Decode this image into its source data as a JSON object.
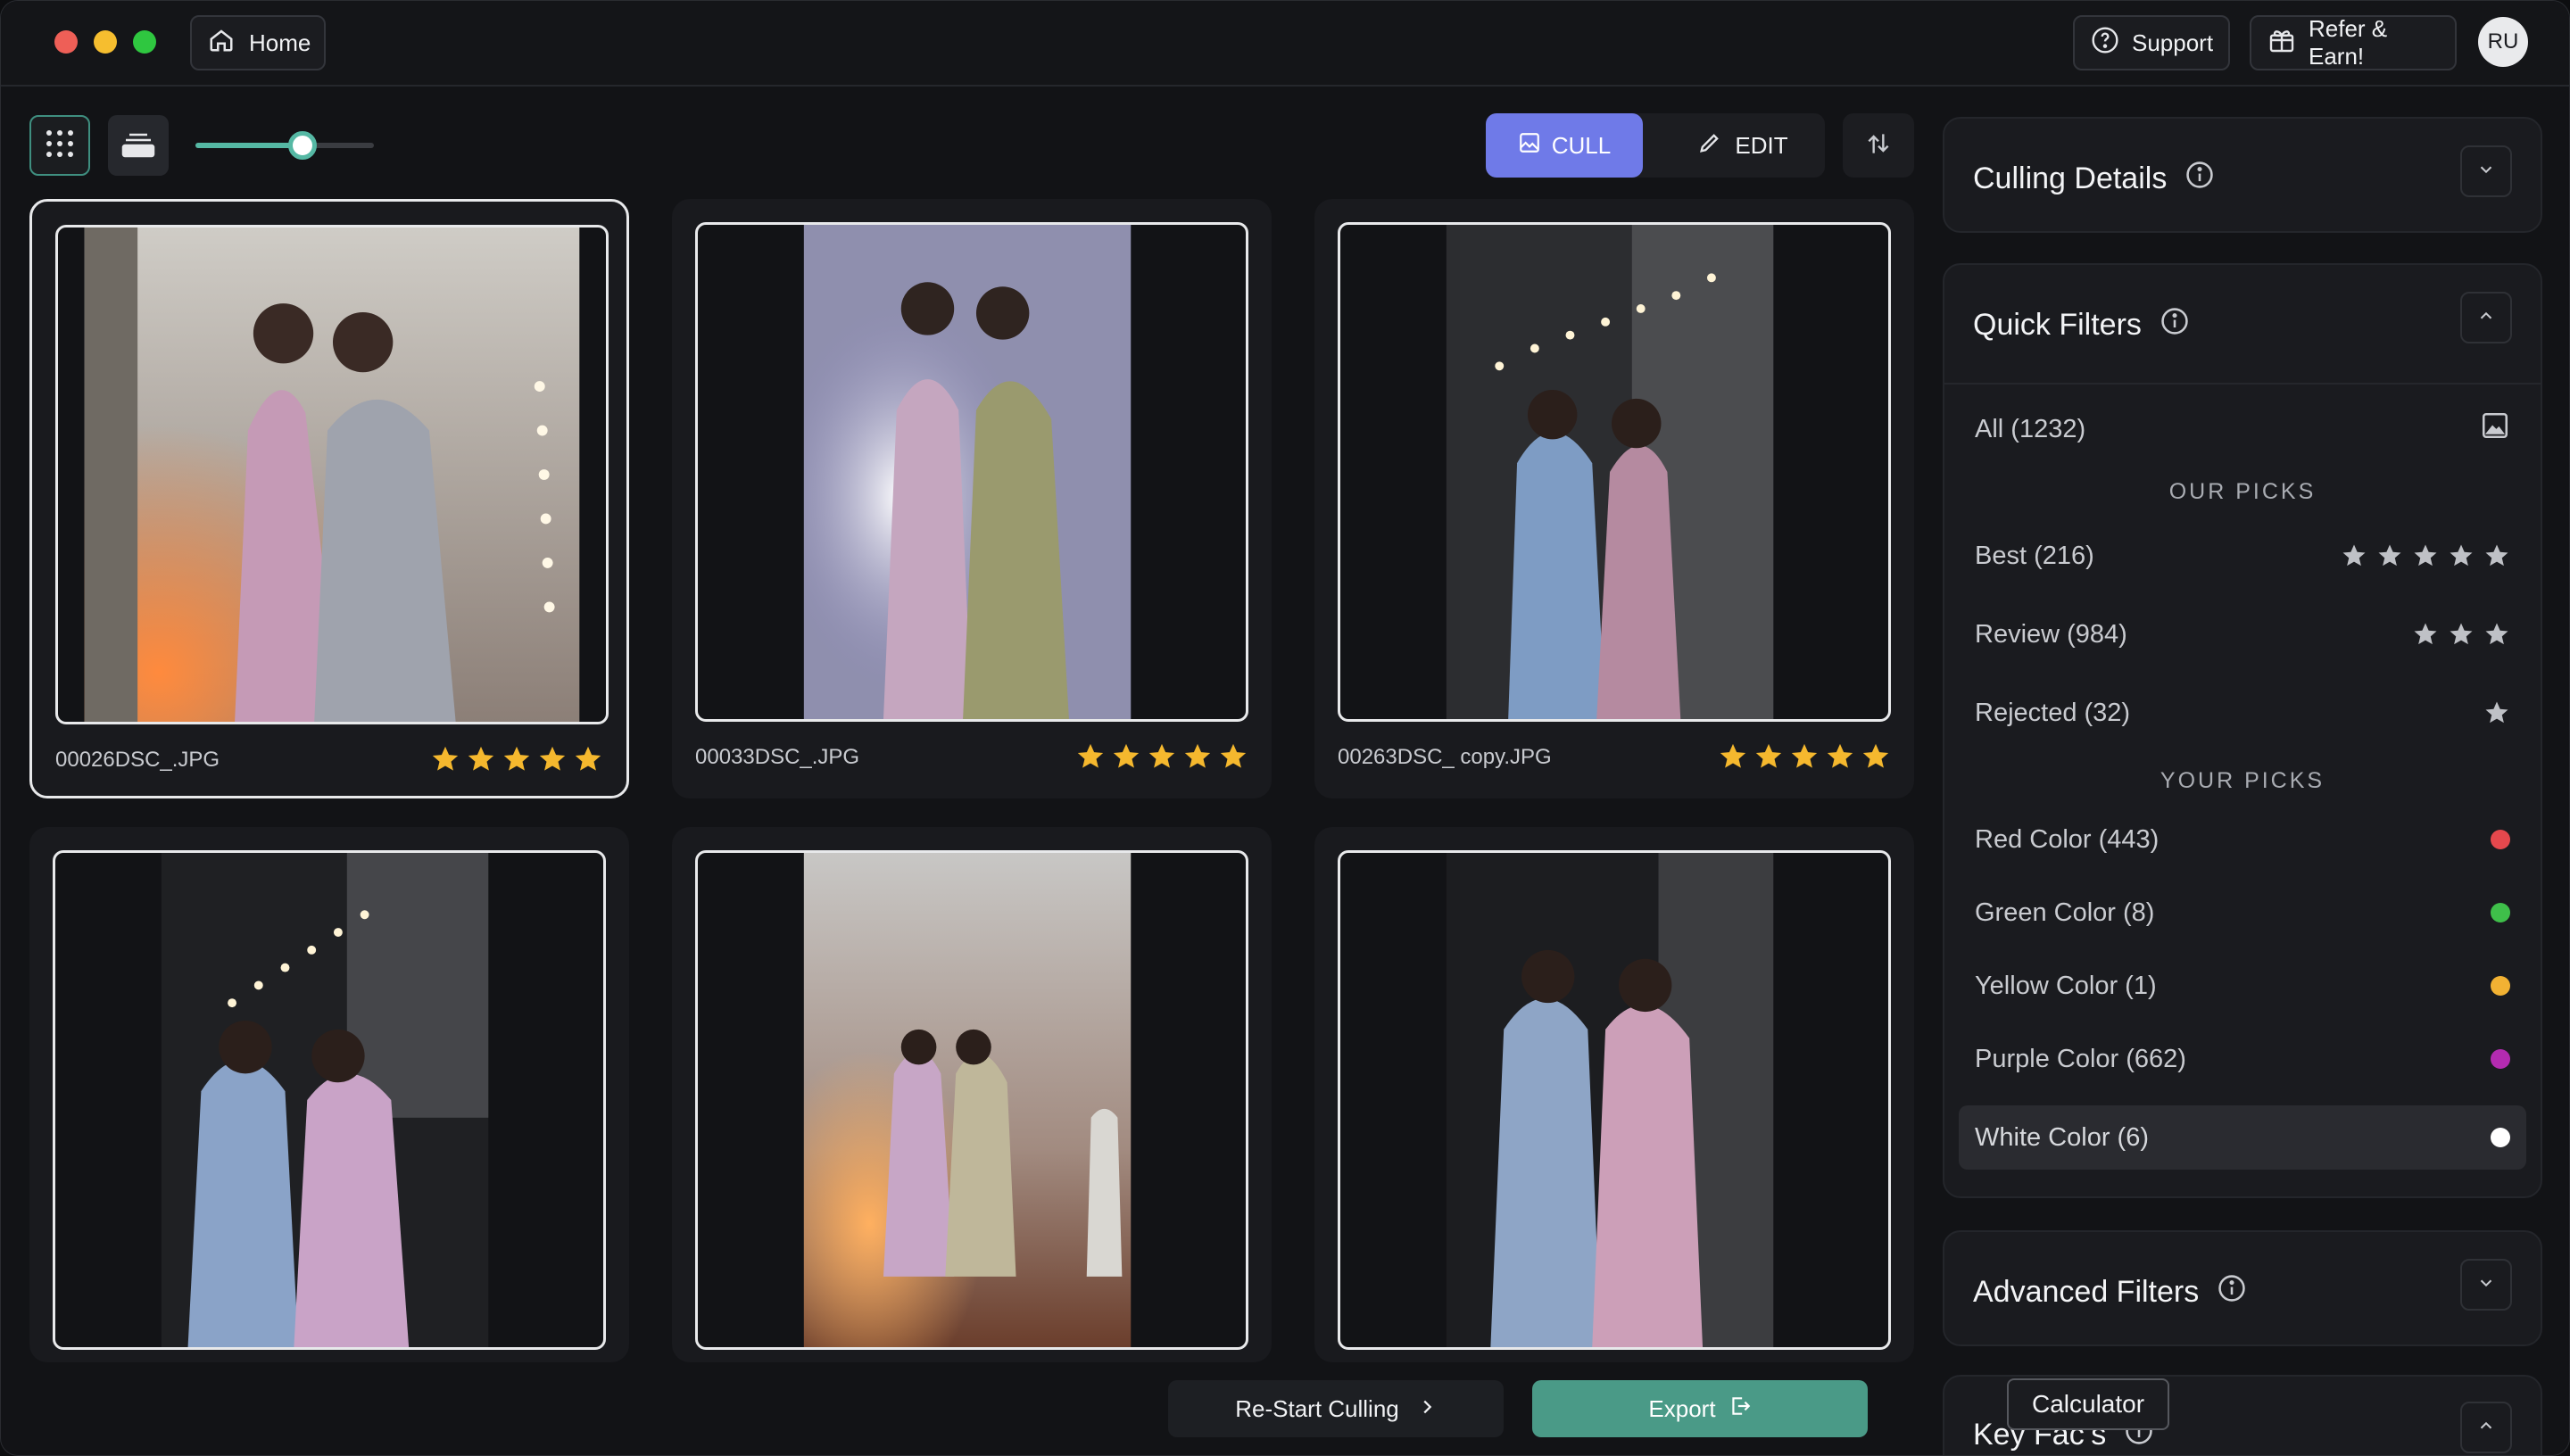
{
  "titlebar": {
    "home_label": "Home",
    "support_label": "Support",
    "refer_label": "Refer & Earn!",
    "avatar_initials": "RU"
  },
  "toolbar": {
    "zoom_level": 0.6,
    "cull_label": "CULL",
    "edit_label": "EDIT"
  },
  "photos": [
    {
      "filename": "00026DSC_.JPG",
      "rating": 5
    },
    {
      "filename": "00033DSC_.JPG",
      "rating": 5
    },
    {
      "filename": "00263DSC_ copy.JPG",
      "rating": 5
    },
    {
      "filename": "",
      "rating": 0
    },
    {
      "filename": "",
      "rating": 0
    },
    {
      "filename": "",
      "rating": 0
    }
  ],
  "bottom": {
    "restart_label": "Re-Start Culling",
    "export_label": "Export"
  },
  "panels": {
    "culling_details": "Culling Details",
    "quick_filters": "Quick Filters",
    "advanced_filters": "Advanced Filters",
    "key_faces": "Key Facʼs"
  },
  "quick_filters": {
    "all": "All (1232)",
    "our_picks_heading": "OUR PICKS",
    "best": "Best (216)",
    "review": "Review (984)",
    "rejected": "Rejected (32)",
    "your_picks_heading": "YOUR PICKS",
    "colors": [
      {
        "label": "Red Color (443)",
        "color": "#e5484d"
      },
      {
        "label": "Green Color (8)",
        "color": "#3fbf4a"
      },
      {
        "label": "Yellow Color (1)",
        "color": "#f2b233"
      },
      {
        "label": "Purple Color (662)",
        "color": "#b42bb0"
      },
      {
        "label": "White Color (6)",
        "color": "#ffffff"
      }
    ]
  },
  "tooltip": "Calculator"
}
